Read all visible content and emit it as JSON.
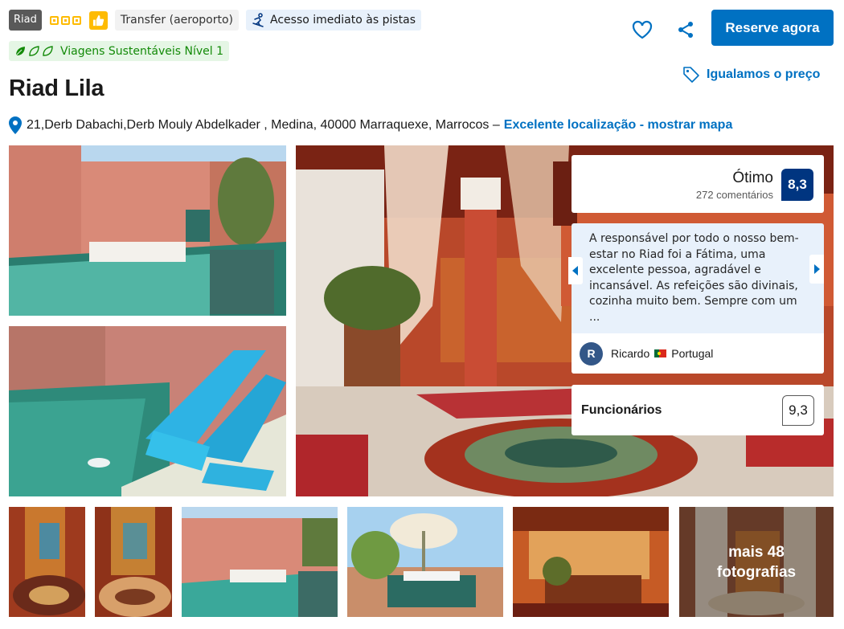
{
  "badges": {
    "property_type": "Riad",
    "star_rating": 3,
    "transfer_label": "Transfer (aeroporto)",
    "ski_label": "Acesso imediato às pistas",
    "sustainability_label": "Viagens Sustentáveis Nível 1"
  },
  "header": {
    "reserve_label": "Reserve agora",
    "price_match_label": "Igualamos o preço",
    "title": "Riad Lila",
    "address": "21,Derb Dabachi,Derb Mouly Abdelkader , Medina, 40000 Marraquexe, Marrocos –",
    "location_link": "Excelente localização - mostrar mapa"
  },
  "review_summary": {
    "score_word": "Ótimo",
    "review_count": "272 comentários",
    "score": "8,3"
  },
  "featured_review": {
    "text": "A responsável por todo o nosso bem-estar no Riad foi a Fátima, uma excelente pessoa, agradável e incansável. As refeições são divinais, cozinha muito bem. Sempre com um ...",
    "author_initial": "R",
    "author_name": "Ricardo",
    "author_country": "Portugal"
  },
  "category_score": {
    "label": "Funcionários",
    "score": "9,3"
  },
  "gallery": {
    "more_photos_label": "mais 48\nfotografias"
  },
  "icons": {
    "thumb": "thumbs-up-icon",
    "ski": "skier-icon",
    "leaf": "leaf-icon",
    "heart": "heart-icon",
    "share": "share-icon",
    "tag": "price-tag-icon",
    "pin": "map-pin-icon",
    "flag": "portugal-flag-icon"
  },
  "colors": {
    "brand_blue": "#0071c2",
    "score_navy": "#003580",
    "star_yellow": "#febb02",
    "sustain_green": "#138a08"
  }
}
